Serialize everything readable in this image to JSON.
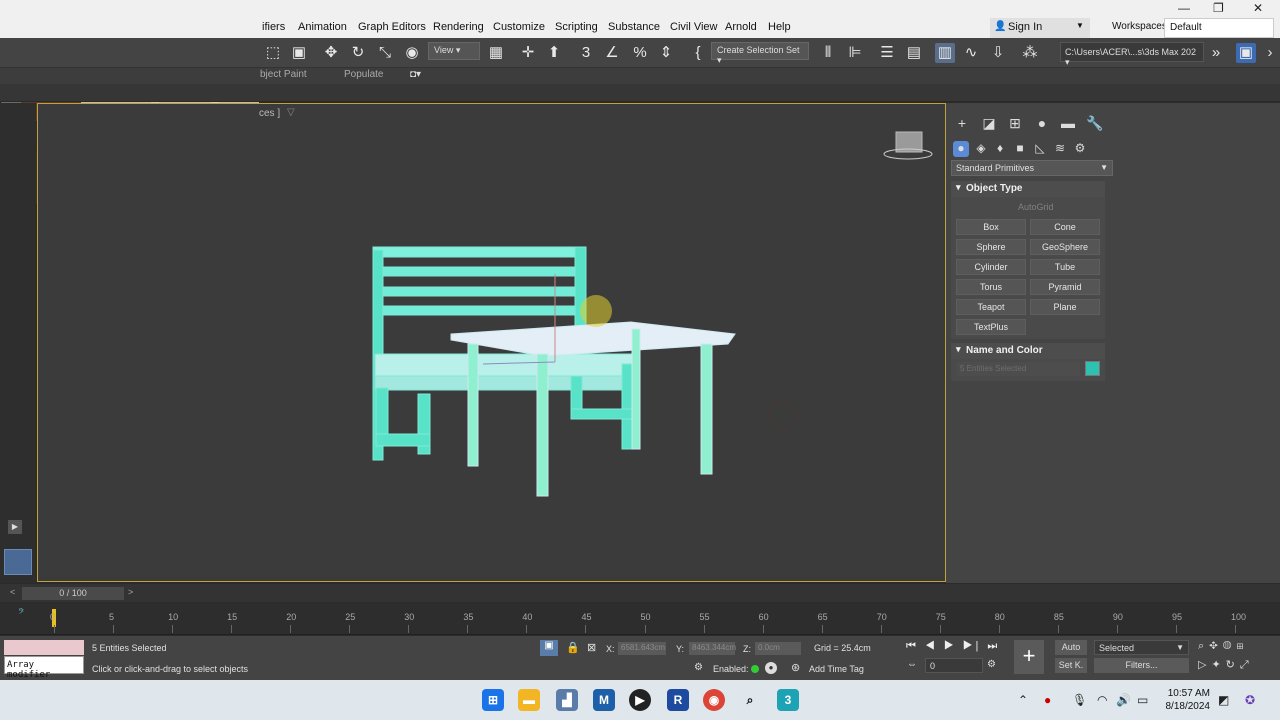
{
  "menus": [
    "ifiers",
    "Animation",
    "Graph Editors",
    "Rendering",
    "Customize",
    "Scripting",
    "Substance",
    "Civil View",
    "Arnold",
    "Help"
  ],
  "account": {
    "sign_in": "Sign In",
    "workspaces_label": "Workspaces:",
    "workspace_value": "Default"
  },
  "toolbar": {
    "view_drop": "View",
    "selection_set": "Create Selection Set",
    "path": "C:\\Users\\ACER\\...s\\3ds Max 202"
  },
  "ribbon": {
    "object_paint": "bject Paint",
    "populate": "Populate"
  },
  "viewport": {
    "label": "ces ]"
  },
  "command_panel": {
    "category": "Standard Primitives",
    "object_type_title": "Object Type",
    "autogrid": "AutoGrid",
    "primitives": [
      "Box",
      "Cone",
      "Sphere",
      "GeoSphere",
      "Cylinder",
      "Tube",
      "Torus",
      "Pyramid",
      "Teapot",
      "Plane",
      "TextPlus"
    ],
    "name_color_title": "Name and Color",
    "name_value": "5 Entities Selected",
    "object_color": "#2ec0b0"
  },
  "timeline": {
    "frame_display": "0 / 100",
    "ticks": [
      "0",
      "5",
      "10",
      "15",
      "20",
      "25",
      "30",
      "35",
      "40",
      "45",
      "50",
      "55",
      "60",
      "65",
      "70",
      "75",
      "80",
      "85",
      "90",
      "95",
      "100"
    ]
  },
  "status": {
    "listener_text": "Array modifier",
    "selected": "5 Entities Selected",
    "prompt": "Click or click-and-drag to select objects",
    "x_label": "X:",
    "x_value": "6581.643cm",
    "y_label": "Y:",
    "y_value": "8463.344cm",
    "z_label": "Z:",
    "z_value": "0.0cm",
    "grid": "Grid = 25.4cm",
    "enabled": "Enabled:",
    "add_time_tag": "Add Time Tag",
    "auto": "Auto",
    "set_key": "Set K.",
    "key_mode": "Selected",
    "filters": "Filters...",
    "frame_field": "0"
  },
  "taskbar": {
    "time": "10:57 AM",
    "date": "8/18/2024"
  }
}
